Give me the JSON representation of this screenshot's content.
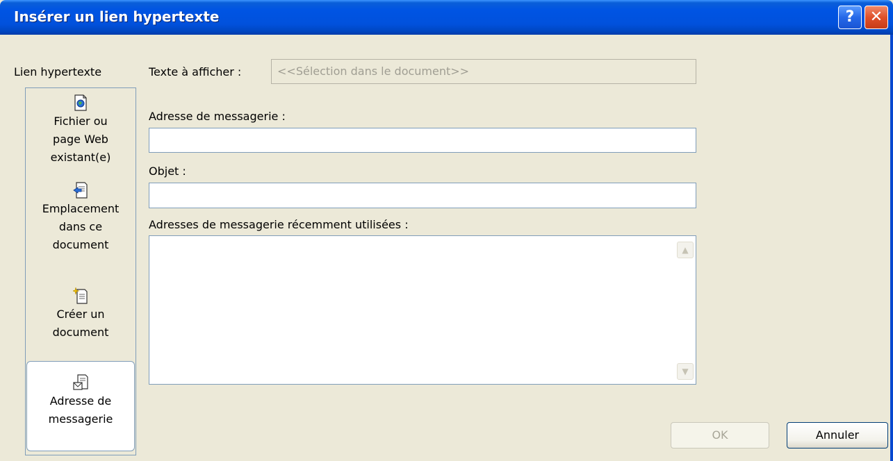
{
  "window": {
    "title": "Insérer un lien hypertexte",
    "help_label": "?",
    "close_label": "✕"
  },
  "sidebar": {
    "heading": "Lien hypertexte",
    "items": [
      {
        "label_lines": [
          "Fichier ou",
          "page Web",
          "existant(e)"
        ],
        "icon": "web-page-file-icon",
        "selected": false
      },
      {
        "label_lines": [
          "Emplacement",
          "dans ce",
          "document"
        ],
        "icon": "document-location-icon",
        "selected": false
      },
      {
        "label_lines": [
          "Créer un",
          "document"
        ],
        "icon": "new-document-icon",
        "selected": false
      },
      {
        "label_lines": [
          "Adresse de",
          "messagerie"
        ],
        "icon": "email-address-icon",
        "selected": true
      }
    ]
  },
  "form": {
    "display_text_label": "Texte à afficher :",
    "display_text_value": "<<Sélection dans le document>>",
    "email_address_label": "Adresse de messagerie :",
    "email_address_value": "",
    "subject_label": "Objet :",
    "subject_value": "",
    "recent_addresses_label": "Adresses de messagerie récemment utilisées :",
    "recent_addresses": []
  },
  "buttons": {
    "ok_label": "OK",
    "ok_enabled": false,
    "cancel_label": "Annuler"
  },
  "colors": {
    "titlebar": "#0054E3",
    "dialog_background": "#ECE9D8",
    "close_button": "#E0502A"
  }
}
